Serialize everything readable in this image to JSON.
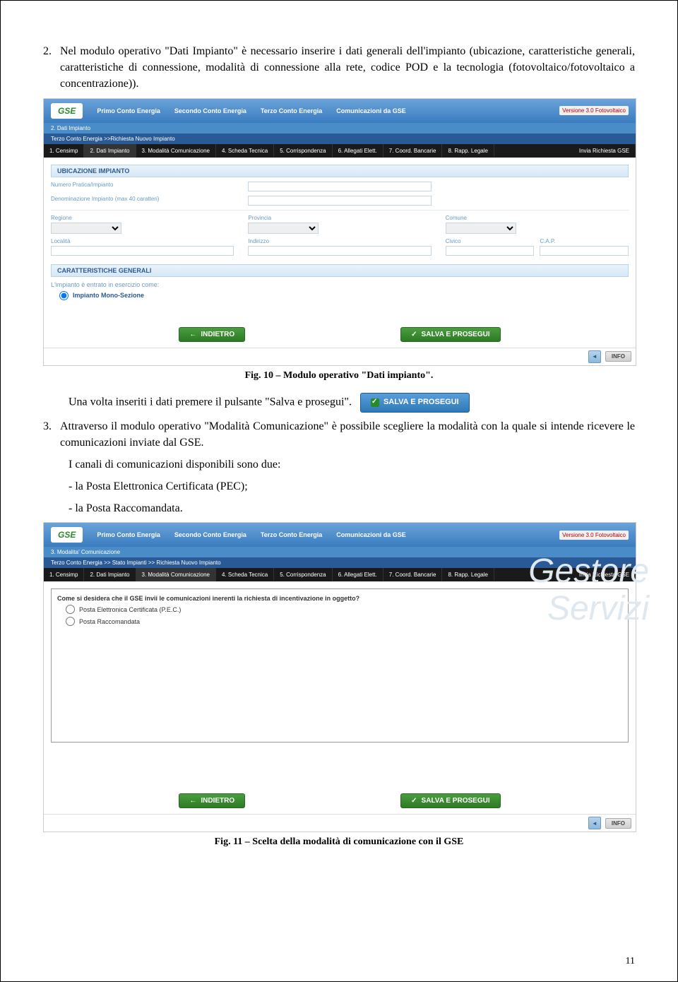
{
  "paragraphs": {
    "p2_num": "2.",
    "p2_text": "Nel modulo operativo \"Dati Impianto\" è necessario inserire i dati generali dell'impianto (ubicazione, caratteristiche generali, caratteristiche di connessione, modalità di connessione alla rete, codice POD e la tecnologia (fotovoltaico/fotovoltaico a concentrazione)).",
    "bold2a": "Dati Impianto",
    "caption10": "Fig. 10 – Modulo operativo \"Dati impianto\".",
    "salva_line": "Una volta inseriti i dati premere il pulsante \"Salva e prosegui\".",
    "salva_btn": "SALVA E PROSEGUI",
    "p3_num": "3.",
    "p3_text": "Attraverso il modulo operativo \"Modalità Comunicazione\" è possibile scegliere la modalità con la quale si intende ricevere le comunicazioni inviate dal GSE.",
    "p3_sub1": "I canali di comunicazioni disponibili sono due:",
    "p3_sub2": "- la Posta Elettronica Certificata (PEC);",
    "p3_sub3": "- la Posta Raccomandata.",
    "caption11": "Fig. 11 – Scelta della modalità di comunicazione con il GSE"
  },
  "screenshot1": {
    "logo": "GSE",
    "nav": [
      "Primo Conto Energia",
      "Secondo Conto Energia",
      "Terzo Conto Energia",
      "Comunicazioni da GSE"
    ],
    "version": "Versione 3.0 Fotovoltaico",
    "bc_title": "2. Dati Impianto",
    "breadcrumb": "Terzo Conto Energia >>Richiesta Nuovo Impianto",
    "tabs": [
      "1. Censimp",
      "2. Dati Impianto",
      "3. Modalità Comunicazione",
      "4. Scheda Tecnica",
      "5. Corrispondenza",
      "6. Allegati Elett.",
      "7. Coord. Bancarie",
      "8. Rapp. Legale",
      "Invia Richiesta GSE"
    ],
    "active_tab": 1,
    "section1": "UBICAZIONE IMPIANTO",
    "f_numpratica": "Numero Pratica/Impianto",
    "f_denom": "Denominazione Impianto (max 40 caratteri)",
    "f_regione": "Regione",
    "f_provincia": "Provincia",
    "f_comune": "Comune",
    "f_localita": "Località",
    "f_indirizzo": "Indirizzo",
    "f_civico": "Civico",
    "f_cap": "C.A.P.",
    "section2": "CARATTERISTICHE GENERALI",
    "car_text": "L'impianto è entrato in esercizio come:",
    "car_opt": "Impianto Mono-Sezione",
    "btn_back": "INDIETRO",
    "btn_save": "SALVA E PROSEGUI",
    "info": "INFO"
  },
  "screenshot2": {
    "bc_title": "3. Modalita' Comunicazione",
    "breadcrumb": "Terzo Conto Energia >> Stato Impianti >> Richiesta Nuovo Impianto",
    "active_tab": 2,
    "question": "Come si desidera che il GSE invii le comunicazioni inerenti la richiesta di incentivazione in oggetto?",
    "opt1": "Posta Elettronica Certificata (P.E.C.)",
    "opt2": "Posta Raccomandata"
  },
  "watermark": {
    "l1": "Gestore",
    "l2": "Servizi"
  },
  "page_number": "11"
}
